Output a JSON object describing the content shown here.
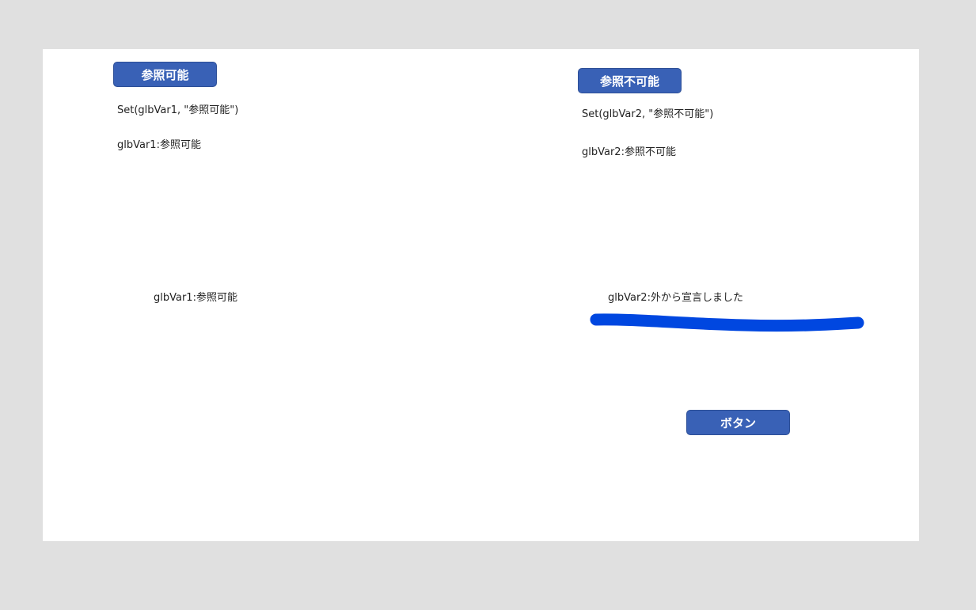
{
  "left_panel": {
    "button_label": "参照可能",
    "set_formula": "Set(glbVar1, \"参照可能\")",
    "value_label": "glbVar1:参照可能",
    "lower_label": "glbVar1:参照可能"
  },
  "right_panel": {
    "button_label": "参照不可能",
    "set_formula": "Set(glbVar2, \"参照不可能\")",
    "value_label": "glbVar2:参照不可能",
    "lower_label": "glbVar2:外から宣言しました"
  },
  "bottom_button": {
    "label": "ボタン"
  },
  "colors": {
    "background": "#e0e0e0",
    "canvas": "#ffffff",
    "button": "#3961b6",
    "pen_stroke": "#0047e0"
  }
}
